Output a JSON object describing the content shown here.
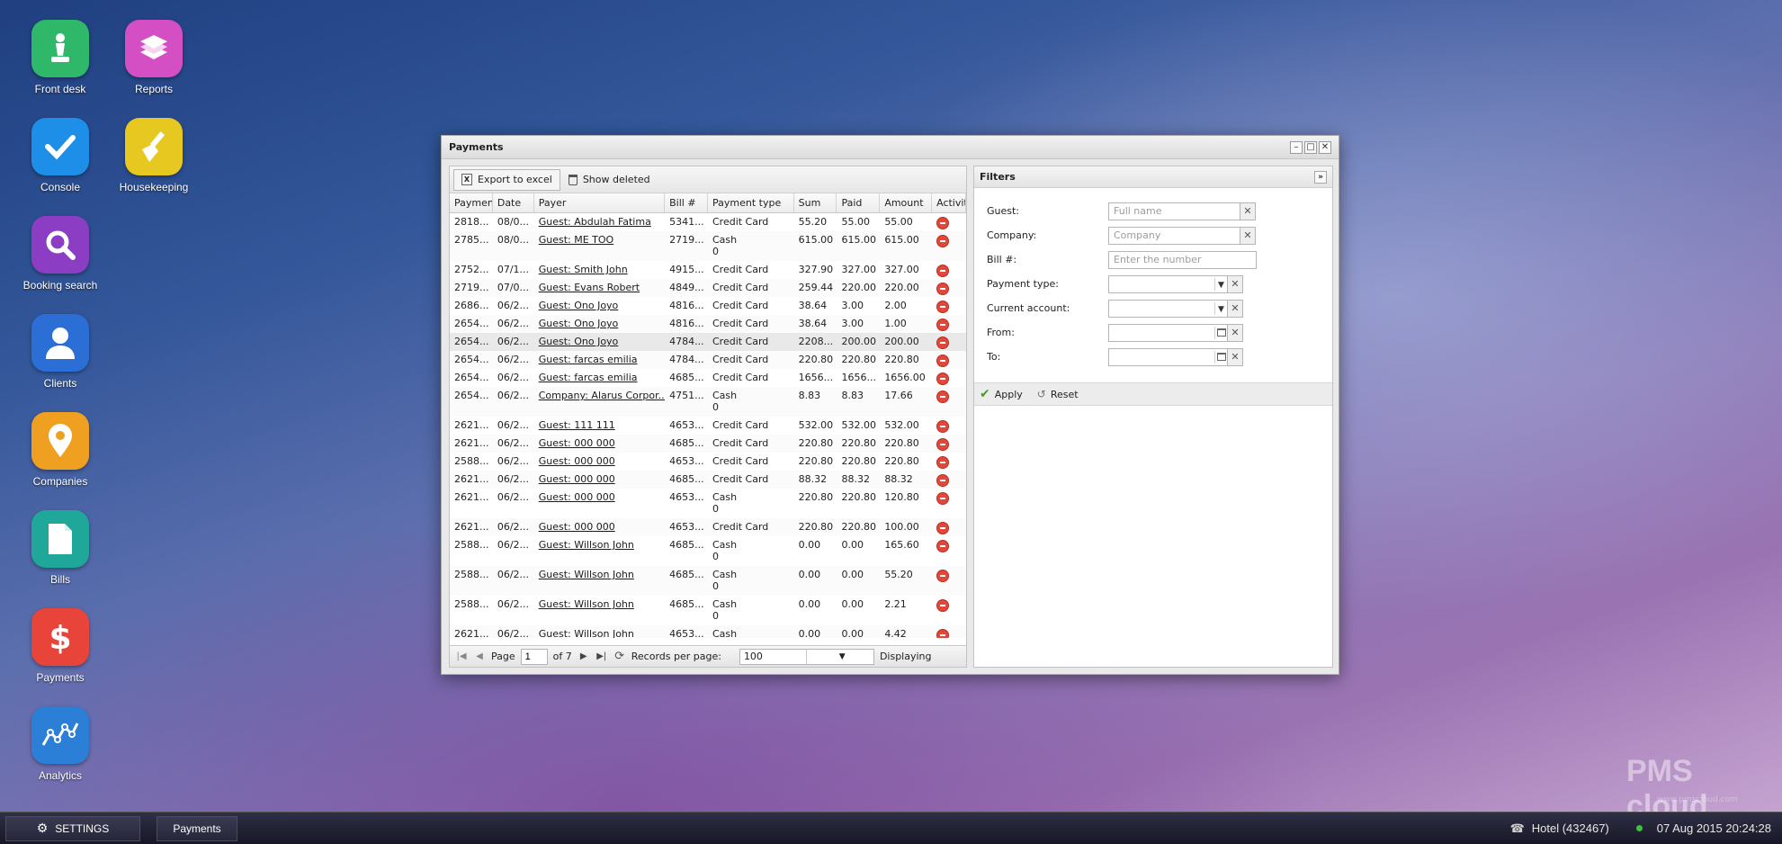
{
  "desktop": {
    "icons": [
      {
        "label": "Front desk",
        "color": "#2fb86a"
      },
      {
        "label": "Reports",
        "color": "#d44ec4"
      },
      {
        "label": "Console",
        "color": "#1e8fe8"
      },
      {
        "label": "Housekeeping",
        "color": "#e6c820"
      },
      {
        "label": "Booking search",
        "color": "#8b3dc4"
      },
      {
        "label": "Clients",
        "color": "#2b6fd6"
      },
      {
        "label": "Companies",
        "color": "#f0a020"
      },
      {
        "label": "Bills",
        "color": "#1fa79a"
      },
      {
        "label": "Payments",
        "color": "#e8443a"
      },
      {
        "label": "Analytics",
        "color": "#2c7fd6"
      }
    ]
  },
  "window": {
    "title": "Payments",
    "toolbar": {
      "export_label": "Export to excel",
      "show_deleted_label": "Show deleted"
    },
    "columns": [
      "Payment",
      "Date",
      "Payer",
      "Bill #",
      "Payment type",
      "Sum",
      "Paid",
      "Amount",
      "Activity"
    ],
    "rows": [
      {
        "id": "2818...",
        "date": "08/0...",
        "payer": "Guest: Abdulah Fatima",
        "bill": "5341...",
        "type": "Credit Card",
        "type2": "",
        "sum": "55.20",
        "paid": "55.00",
        "amount": "55.00"
      },
      {
        "id": "2785...",
        "date": "08/0...",
        "payer": "Guest: ME TOO",
        "bill": "2719...",
        "type": "Cash",
        "type2": "0",
        "sum": "615.00",
        "paid": "615.00",
        "amount": "615.00"
      },
      {
        "id": "2752...",
        "date": "07/1...",
        "payer": "Guest: Smith John",
        "bill": "4915...",
        "type": "Credit Card",
        "type2": "",
        "sum": "327.90",
        "paid": "327.00",
        "amount": "327.00"
      },
      {
        "id": "2719...",
        "date": "07/0...",
        "payer": "Guest: Evans Robert",
        "bill": "4849...",
        "type": "Credit Card",
        "type2": "",
        "sum": "259.44",
        "paid": "220.00",
        "amount": "220.00"
      },
      {
        "id": "2686...",
        "date": "06/2...",
        "payer": "Guest: Ono Joyo",
        "bill": "4816...",
        "type": "Credit Card",
        "type2": "",
        "sum": "38.64",
        "paid": "3.00",
        "amount": "2.00"
      },
      {
        "id": "2654...",
        "date": "06/2...",
        "payer": "Guest: Ono Joyo",
        "bill": "4816...",
        "type": "Credit Card",
        "type2": "",
        "sum": "38.64",
        "paid": "3.00",
        "amount": "1.00"
      },
      {
        "id": "2654...",
        "date": "06/2...",
        "payer": "Guest: Ono Joyo",
        "bill": "4784...",
        "type": "Credit Card",
        "type2": "",
        "sum": "2208...",
        "paid": "200.00",
        "amount": "200.00"
      },
      {
        "id": "2654...",
        "date": "06/2...",
        "payer": "Guest: farcas emilia",
        "bill": "4784...",
        "type": "Credit Card",
        "type2": "",
        "sum": "220.80",
        "paid": "220.80",
        "amount": "220.80"
      },
      {
        "id": "2654...",
        "date": "06/2...",
        "payer": "Guest: farcas emilia",
        "bill": "4685...",
        "type": "Credit Card",
        "type2": "",
        "sum": "1656...",
        "paid": "1656...",
        "amount": "1656.00"
      },
      {
        "id": "2654...",
        "date": "06/2...",
        "payer": "Company: Alarus Corpor...",
        "bill": "4751...",
        "type": "Cash",
        "type2": "0",
        "sum": "8.83",
        "paid": "8.83",
        "amount": "17.66"
      },
      {
        "id": "2621...",
        "date": "06/2...",
        "payer": "Guest: 111 111",
        "bill": "4653...",
        "type": "Credit Card",
        "type2": "",
        "sum": "532.00",
        "paid": "532.00",
        "amount": "532.00"
      },
      {
        "id": "2621...",
        "date": "06/2...",
        "payer": "Guest: 000 000",
        "bill": "4685...",
        "type": "Credit Card",
        "type2": "",
        "sum": "220.80",
        "paid": "220.80",
        "amount": "220.80"
      },
      {
        "id": "2588...",
        "date": "06/2...",
        "payer": "Guest: 000 000",
        "bill": "4653...",
        "type": "Credit Card",
        "type2": "",
        "sum": "220.80",
        "paid": "220.80",
        "amount": "220.80"
      },
      {
        "id": "2621...",
        "date": "06/2...",
        "payer": "Guest: 000 000",
        "bill": "4685...",
        "type": "Credit Card",
        "type2": "",
        "sum": "88.32",
        "paid": "88.32",
        "amount": "88.32"
      },
      {
        "id": "2621...",
        "date": "06/2...",
        "payer": "Guest: 000 000",
        "bill": "4653...",
        "type": "Cash",
        "type2": "0",
        "sum": "220.80",
        "paid": "220.80",
        "amount": "120.80"
      },
      {
        "id": "2621...",
        "date": "06/2...",
        "payer": "Guest: 000 000",
        "bill": "4653...",
        "type": "Credit Card",
        "type2": "",
        "sum": "220.80",
        "paid": "220.80",
        "amount": "100.00"
      },
      {
        "id": "2588...",
        "date": "06/2...",
        "payer": "Guest: Willson John",
        "bill": "4685...",
        "type": "Cash",
        "type2": "0",
        "sum": "0.00",
        "paid": "0.00",
        "amount": "165.60"
      },
      {
        "id": "2588...",
        "date": "06/2...",
        "payer": "Guest: Willson John",
        "bill": "4685...",
        "type": "Cash",
        "type2": "0",
        "sum": "0.00",
        "paid": "0.00",
        "amount": "55.20"
      },
      {
        "id": "2588...",
        "date": "06/2...",
        "payer": "Guest: Willson John",
        "bill": "4685...",
        "type": "Cash",
        "type2": "0",
        "sum": "0.00",
        "paid": "0.00",
        "amount": "2.21"
      },
      {
        "id": "2621...",
        "date": "06/2...",
        "payer": "Guest: Willson John",
        "bill": "4653...",
        "type": "Cash",
        "type2": "",
        "sum": "0.00",
        "paid": "0.00",
        "amount": "4.42"
      }
    ],
    "pager": {
      "page_label": "Page",
      "page_value": "1",
      "of_label": "of 7",
      "records_label": "Records per page:",
      "records_value": "100",
      "displaying_label": "Displaying"
    },
    "filters": {
      "title": "Filters",
      "guest_label": "Guest:",
      "guest_placeholder": "Full name",
      "company_label": "Company:",
      "company_placeholder": "Company",
      "bill_label": "Bill #:",
      "bill_placeholder": "Enter the number",
      "ptype_label": "Payment type:",
      "account_label": "Current account:",
      "from_label": "From:",
      "to_label": "To:",
      "apply_label": "Apply",
      "reset_label": "Reset"
    }
  },
  "taskbar": {
    "settings_label": "SETTINGS",
    "payments_label": "Payments",
    "hotel_label": "Hotel (432467)",
    "datetime": "07 Aug 2015 20:24:28"
  },
  "watermark": {
    "text": "PMS cloud",
    "url": "www.pmscloud.com"
  }
}
